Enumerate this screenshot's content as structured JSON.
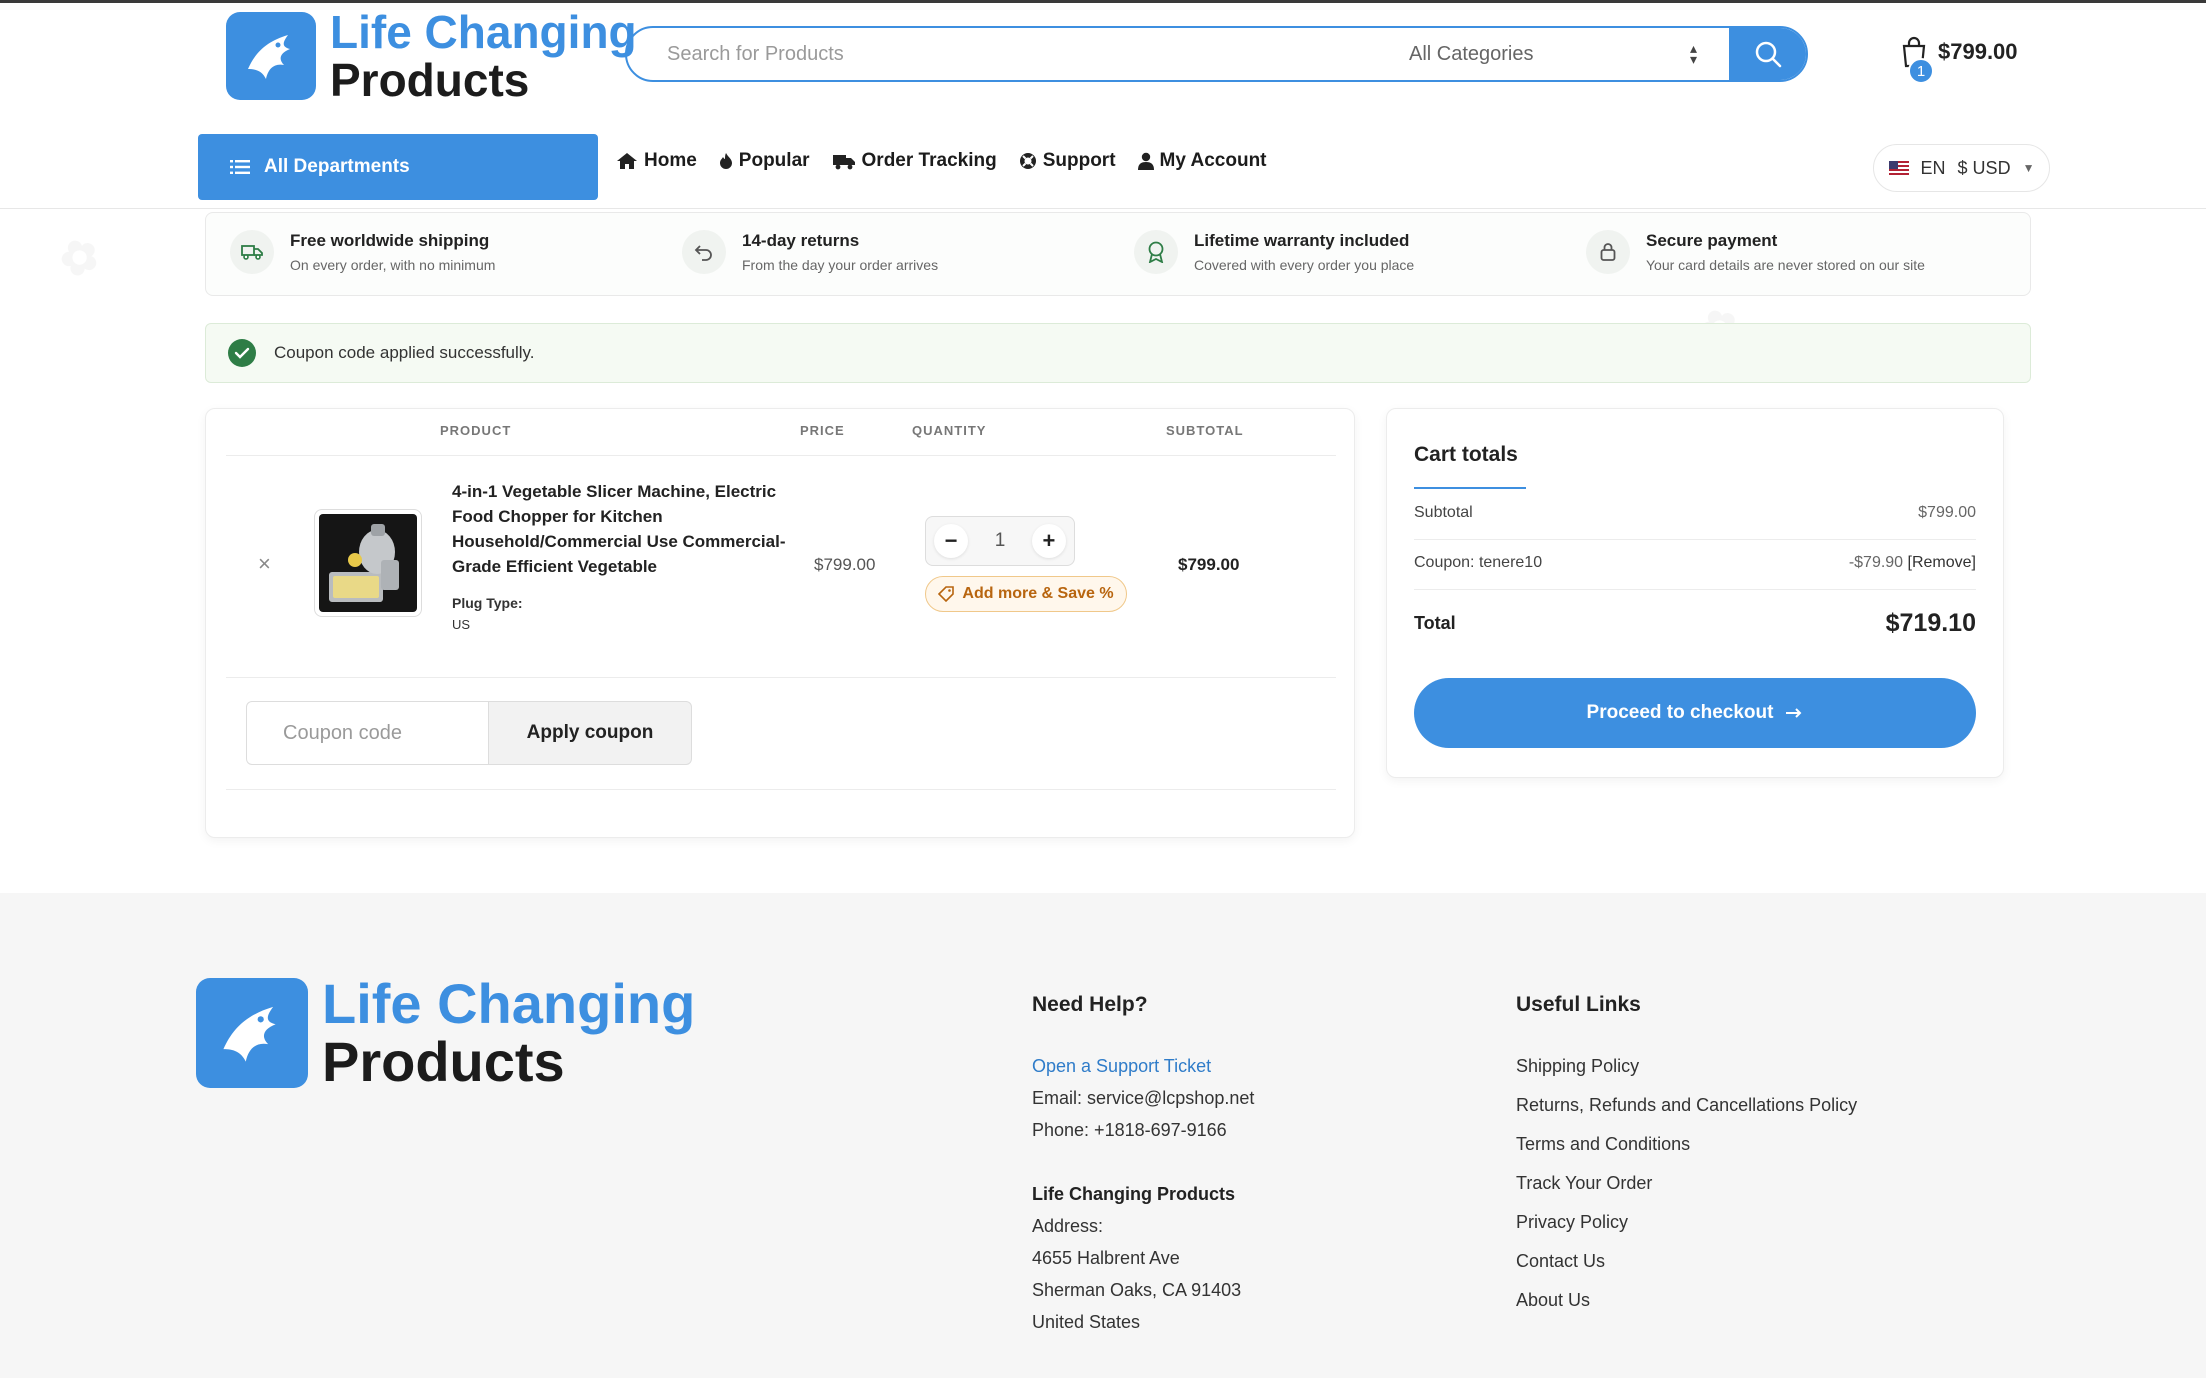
{
  "brand": {
    "line1": "Life Changing",
    "line2": "Products",
    "color": "#3d8fe0"
  },
  "search": {
    "placeholder": "Search for Products",
    "category": "All Categories"
  },
  "cart": {
    "count": "1",
    "total": "$799.00"
  },
  "nav": {
    "departments": "All Departments",
    "items": [
      "Home",
      "Popular",
      "Order Tracking",
      "Support",
      "My Account"
    ]
  },
  "locale": {
    "language": "EN",
    "currency": "$ USD"
  },
  "features": [
    {
      "title": "Free worldwide shipping",
      "sub": "On every order, with no minimum",
      "icon": "truck-icon"
    },
    {
      "title": "14-day returns",
      "sub": "From the day your order arrives",
      "icon": "return-icon"
    },
    {
      "title": "Lifetime warranty included",
      "sub": "Covered with every order you place",
      "icon": "award-icon"
    },
    {
      "title": "Secure payment",
      "sub": "Your card details are never stored on our site",
      "icon": "lock-icon"
    }
  ],
  "notice": {
    "text": "Coupon code applied successfully.",
    "color": "#2e7d46"
  },
  "table": {
    "headers": {
      "product": "PRODUCT",
      "price": "PRICE",
      "quantity": "QUANTITY",
      "subtotal": "SUBTOTAL"
    },
    "row": {
      "remove": "×",
      "name": "4-in-1 Vegetable Slicer Machine, Electric Food Chopper for Kitchen Household/Commercial Use Commercial-Grade Efficient Vegetable",
      "meta_label": "Plug Type:",
      "meta_value": "US",
      "price": "$799.00",
      "quantity": "1",
      "addmore": "Add more & Save %",
      "subtotal": "$799.00"
    },
    "coupon_placeholder": "Coupon code",
    "apply_label": "Apply coupon"
  },
  "totals": {
    "title": "Cart totals",
    "subtotal_label": "Subtotal",
    "subtotal_value": "$799.00",
    "coupon_label": "Coupon: tenere10",
    "coupon_value": "-$79.90",
    "coupon_remove": "[Remove]",
    "total_label": "Total",
    "total_value": "$719.10",
    "checkout_label": "Proceed to checkout"
  },
  "footer": {
    "help_title": "Need Help?",
    "ticket_link": "Open a Support Ticket",
    "email": "Email: service@lcpshop.net",
    "phone": "Phone: +1818-697-9166",
    "company": "Life Changing Products",
    "address_label": "Address:",
    "address1": "4655 Halbrent Ave",
    "address2": "Sherman Oaks, CA 91403",
    "address3": "United States",
    "links_title": "Useful Links",
    "links": [
      "Shipping Policy",
      "Returns, Refunds and Cancellations Policy",
      "Terms and Conditions",
      "Track Your Order",
      "Privacy Policy",
      "Contact Us",
      "About Us"
    ]
  }
}
